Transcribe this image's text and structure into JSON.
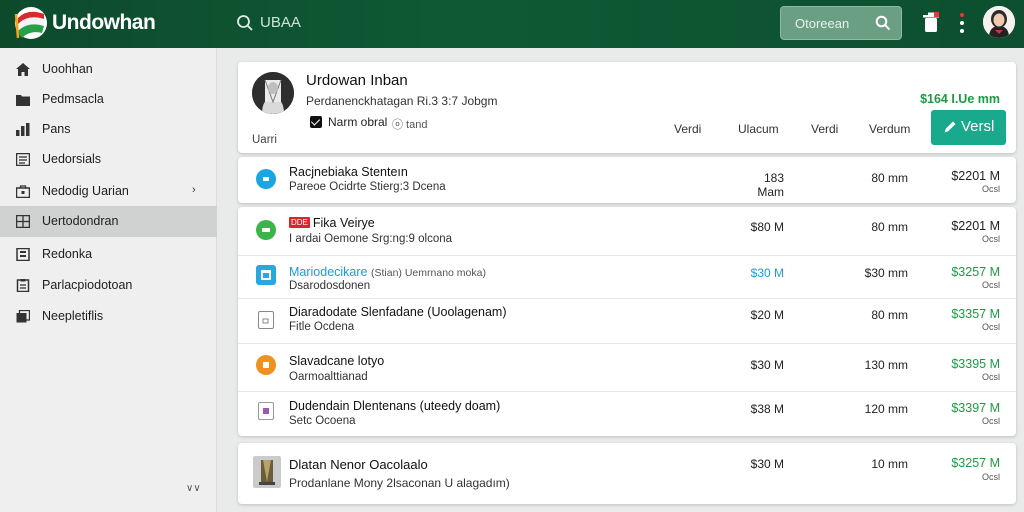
{
  "app": {
    "title": "Undowhan"
  },
  "topbar": {
    "search_text": "UBAA",
    "search_box_text": "Otoreean"
  },
  "sidebar": {
    "items": [
      {
        "label": "Uoohhan",
        "icon": "home-icon"
      },
      {
        "label": "Pedmsacla",
        "icon": "folder-icon"
      },
      {
        "label": "Pans",
        "icon": "chart-icon"
      },
      {
        "label": "Uedorsials",
        "icon": "document-icon"
      },
      {
        "label": "Nedodig Uarian",
        "icon": "bag-icon"
      },
      {
        "label": "Uertodondran",
        "icon": "grid-icon"
      },
      {
        "label": "Redonka",
        "icon": "list-icon"
      },
      {
        "label": "Parlacpiodotoan",
        "icon": "clipboard-icon"
      },
      {
        "label": "Neepletiflis",
        "icon": "stack-icon"
      }
    ],
    "active_index": 5
  },
  "profile": {
    "name": "Urdowan Inban",
    "subtitle": "Perdanenckhatagan Ri.3 3:7 Jobgm",
    "checkbox_label": "Narm obral",
    "checkbox_hint": "ⓞ tand",
    "role": "Uarri",
    "columns": [
      "Verdi",
      "Ulacum",
      "Verdi",
      "Verdum"
    ],
    "price_header": "$164 I.Ue mm",
    "view_button": "Versl"
  },
  "row_item": {
    "title": "Racjnebiaka Stenteın",
    "subtitle": "Pareoe Ocidrte Stierg:3 Dcena",
    "col1": "183 Mam",
    "col2": "80 mm",
    "price": "$2201 M",
    "price_sub": "Ocsl",
    "icon_color": "#1aa6e0"
  },
  "list_items": [
    {
      "tag": "DDE",
      "title": "Fika Veirye",
      "subtitle": "I ardai Oemone Srg:ng:9 olcona",
      "col1": "$80 M",
      "col2": "80 mm",
      "price": "$2201 M",
      "price_sub": "Ocsl",
      "price_green": false,
      "icon_color": "#3bb54a",
      "title_blue": false,
      "col1_blue": false
    },
    {
      "tag": "",
      "title": "Mariodecikare",
      "title_extra": "(Stian) Uemrnano moka)",
      "subtitle": "Dsarodosdonen",
      "col1": "$30 M",
      "col2": "$30 mm",
      "price": "$3257 M",
      "price_sub": "Ocsl",
      "price_green": true,
      "icon_color": "#2aa8dd",
      "title_blue": true,
      "col1_blue": true
    },
    {
      "tag": "",
      "title": "Diaradodate Slenfadane (Uoolagenam)",
      "subtitle": "Fitle Ocdena",
      "col1": "$20 M",
      "col2": "80 mm",
      "price": "$3357 M",
      "price_sub": "Ocsl",
      "price_green": true,
      "icon_color": "#888888",
      "title_blue": false,
      "col1_blue": false
    },
    {
      "tag": "",
      "title": "Slavadcane lotyo",
      "subtitle": "Oarmoalttianad",
      "col1": "$30 M",
      "col2": "130 mm",
      "price": "$3395 M",
      "price_sub": "Ocsl",
      "price_green": true,
      "icon_color": "#f0901e",
      "title_blue": false,
      "col1_blue": false
    },
    {
      "tag": "",
      "title": "Dudendain Dlentenans (uteedy doam)",
      "subtitle": "Setc Ocoena",
      "col1": "$38 M",
      "col2": "120 mm",
      "price": "$3397 M",
      "price_sub": "Ocsl",
      "price_green": true,
      "icon_color": "#9b59b6",
      "title_blue": false,
      "col1_blue": false
    }
  ],
  "bottom_item": {
    "title": "Dlatan Nenor Oacolaalo",
    "subtitle": "Prodanlane Mony 2lsaconan U alagadım)",
    "col1": "$30 M",
    "col2": "10 mm",
    "price": "$3257 M",
    "price_sub": "Ocsl"
  },
  "colors": {
    "topbar": "#0f5a35",
    "accent_button": "#19a98c",
    "price_green": "#1a9c44"
  }
}
